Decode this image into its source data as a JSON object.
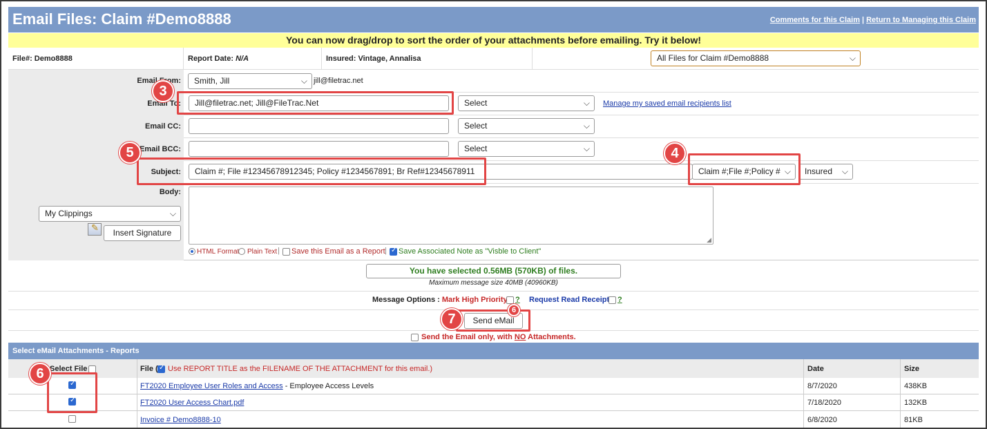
{
  "header": {
    "title": "Email Files: Claim #Demo8888",
    "link_comments": "Comments for this Claim",
    "link_separator": "|",
    "link_return": "Return to Managing this Claim"
  },
  "banner": "You can now drag/drop to sort the order of your attachments before emailing. Try it below!",
  "info": {
    "file_label": "File#: Demo8888",
    "report_date_label": "Report Date:",
    "report_date_value": "N/A",
    "insured_label": "Insured: Vintage, Annalisa",
    "files_select": "All Files for Claim #Demo8888"
  },
  "form": {
    "email_from_label": "Email From:",
    "email_from_value": "Smith, Jill",
    "email_from_address": "jill@filetrac.net",
    "email_to_label": "Email To:",
    "email_to_value": "Jill@filetrac.net; Jill@FileTrac.Net",
    "select_label": "Select",
    "manage_recipients": "Manage my saved email recipients list",
    "email_cc_label": "Email CC:",
    "email_bcc_label": "Email BCC:",
    "subject_label": "Subject:",
    "subject_value": "Claim #; File #12345678912345; Policy #1234567891; Br Ref#12345678911",
    "subject_tokens": "Claim #;File #;Policy #",
    "insured_select": "Insured",
    "body_label": "Body:",
    "clippings": "My Clippings",
    "insert_signature": "Insert Signature",
    "html_format": "HTML Format",
    "plain_text": "Plain Text",
    "pipe": "|",
    "save_report": "Save this Email as a Report",
    "save_note": "Save Associated Note as \"Visble to Client\""
  },
  "size": {
    "selected": "You have selected 0.56MB (570KB) of files.",
    "max": "Maximum message size 40MB (40960KB)"
  },
  "options": {
    "label": "Message Options :",
    "high_priority": "Mark High Priority",
    "q1": "?",
    "read_receipt": "Request Read Receipt",
    "q2": "?",
    "send_button": "Send eMail",
    "no_attach_prefix": "Send the Email only, with",
    "no_attach_no": "NO",
    "no_attach_suffix": "Attachments."
  },
  "attachments": {
    "header": "Select eMail Attachments - Reports",
    "col_select": "Select File",
    "col_file_prefix": "File (",
    "col_file_note": "Use REPORT TITLE as the FILENAME OF THE ATTACHMENT for this email.)",
    "col_date": "Date",
    "col_size": "Size",
    "rows": [
      {
        "name": "FT2020 Employee User Roles and Access",
        "desc": " - Employee Access Levels",
        "date": "8/7/2020",
        "size": "438KB"
      },
      {
        "name": "FT2020 User Access Chart.pdf",
        "desc": "",
        "date": "7/18/2020",
        "size": "132KB"
      },
      {
        "name": "Invoice # Demo8888-10",
        "desc": "",
        "date": "6/8/2020",
        "size": "81KB"
      }
    ]
  },
  "callouts": {
    "b3": "3",
    "b4": "4",
    "b5": "5",
    "b6_small": "6",
    "b7": "7",
    "b6": "6"
  },
  "colors": {
    "header_blue": "#7b9ac8",
    "banner_yellow": "#ffff99",
    "callout_red": "#e24545"
  }
}
